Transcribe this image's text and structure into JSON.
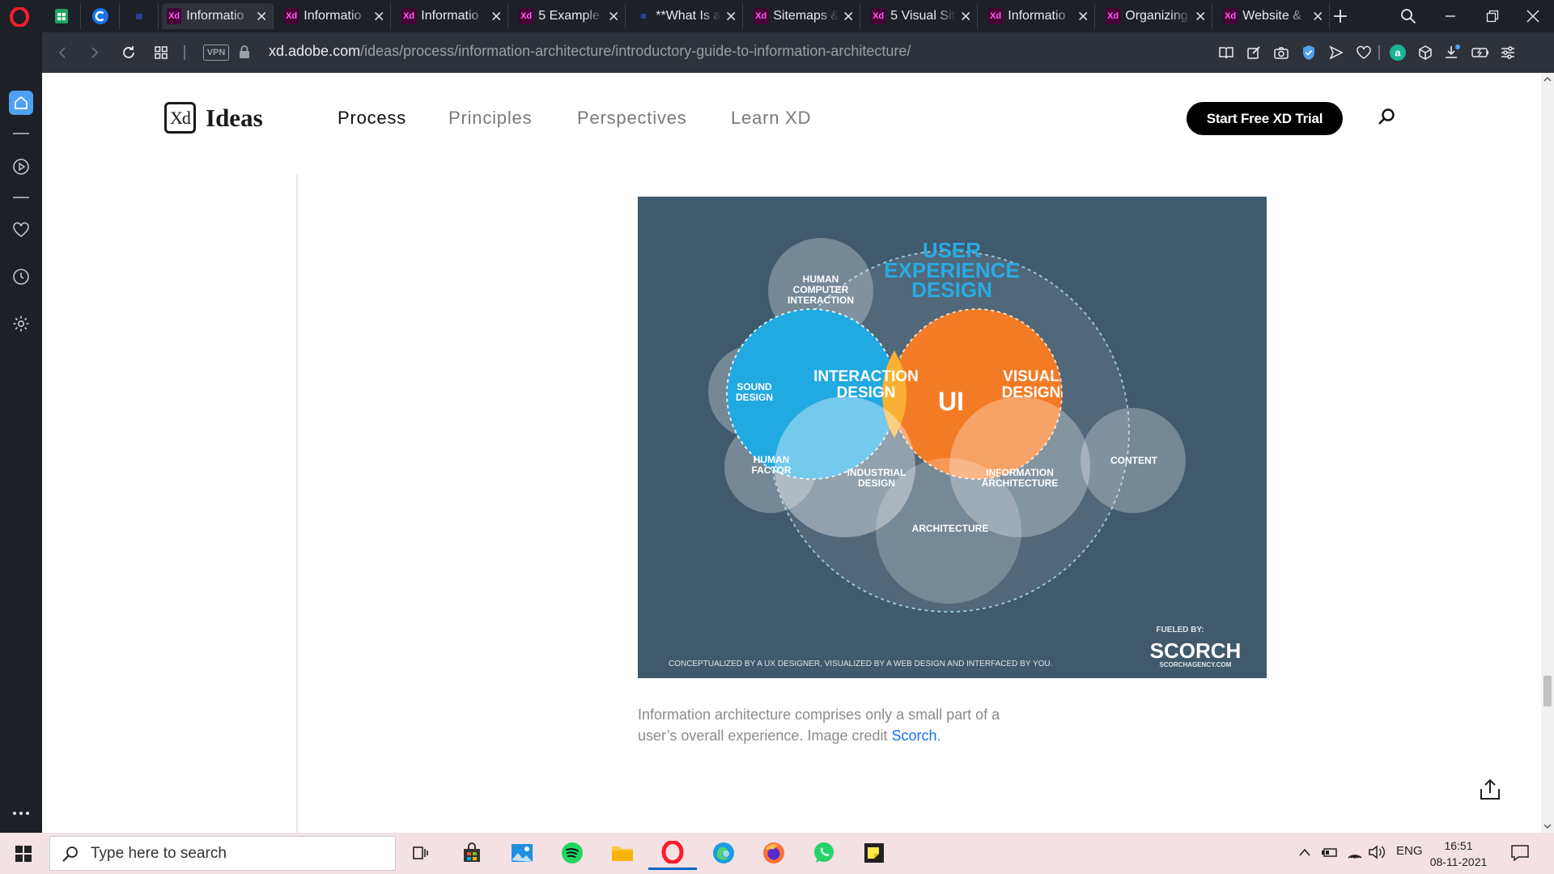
{
  "browser": {
    "tabs": [
      {
        "title": "Informatio",
        "favicon": "xd-icon",
        "active": true
      },
      {
        "title": "Informatio",
        "favicon": "xd-icon",
        "active": false
      },
      {
        "title": "Informatio",
        "favicon": "xd-icon",
        "active": false
      },
      {
        "title": "5 Example",
        "favicon": "xd-icon",
        "active": false
      },
      {
        "title": "**What Is a",
        "favicon": "page-icon",
        "active": false
      },
      {
        "title": "Sitemaps &",
        "favicon": "xd-icon",
        "active": false
      },
      {
        "title": "5 Visual Sit",
        "favicon": "xd-icon",
        "active": false
      },
      {
        "title": "Informatio",
        "favicon": "xd-icon",
        "active": false
      },
      {
        "title": "Organizing",
        "favicon": "xd-icon",
        "active": false
      },
      {
        "title": "Website &",
        "favicon": "xd-icon",
        "active": false
      }
    ],
    "favicon_text": "Xd",
    "vpn_label": "VPN",
    "url_host": "xd.adobe.com",
    "url_path": "/ideas/process/information-architecture/introductory-guide-to-information-architecture/"
  },
  "site": {
    "logo_mark": "Xd",
    "logo_word": "Ideas",
    "nav": [
      {
        "label": "Process",
        "active": true
      },
      {
        "label": "Principles",
        "active": false
      },
      {
        "label": "Perspectives",
        "active": false
      },
      {
        "label": "Learn XD",
        "active": false
      }
    ],
    "cta_label": "Start Free XD Trial"
  },
  "figure": {
    "title_line1": "USER",
    "title_line2": "EXPERIENCE",
    "title_line3": "DESIGN",
    "interaction_line1": "INTERACTION",
    "interaction_line2": "DESIGN",
    "visual_line1": "VISUAL",
    "visual_line2": "DESIGN",
    "ui": "UI",
    "hci_line1": "HUMAN",
    "hci_line2": "COMPUTER",
    "hci_line3": "INTERACTION",
    "sound_line1": "SOUND",
    "sound_line2": "DESIGN",
    "human_line1": "HUMAN",
    "human_line2": "FACTOR",
    "industrial_line1": "INDUSTRIAL",
    "industrial_line2": "DESIGN",
    "ia_line1": "INFORMATION",
    "ia_line2": "ARCHITECTURE",
    "content": "CONTENT",
    "architecture": "ARCHITECTURE",
    "fueled_by": "FUELED BY:",
    "brand": "SCORCH",
    "brand_url": "SCORCHAGENCY.COM",
    "footer": "CONCEPTUALIZED BY A UX DESIGNER, VISUALIZED BY A WEB DESIGN AND INTERFACED BY YOU.",
    "colors": {
      "background": "#3f5a6d",
      "interaction": "#21a9e1",
      "visual": "#f47b26",
      "ui": "#f9b233",
      "ux_title": "#29abe2"
    }
  },
  "caption": {
    "text": "Information architecture comprises only a small part of a user’s overall experience. Image credit ",
    "link": "Scorch",
    "end": "."
  },
  "taskbar": {
    "search_placeholder": "Type here to search",
    "lang": "ENG",
    "time": "16:51",
    "date": "08-11-2021"
  }
}
